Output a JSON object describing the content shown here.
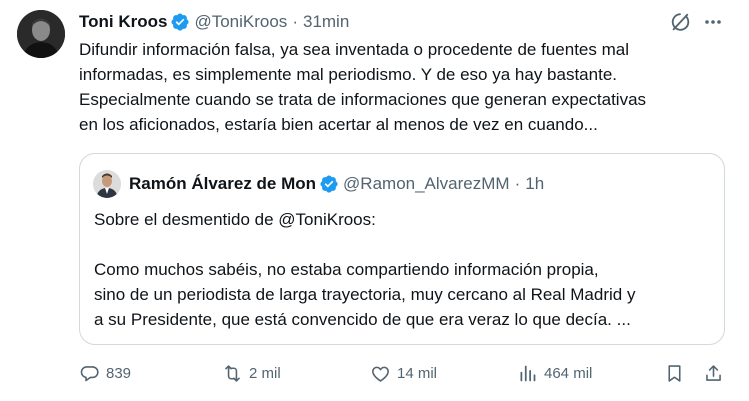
{
  "tweet": {
    "author_name": "Toni Kroos",
    "author_handle": "@ToniKroos",
    "separator": "·",
    "time": "31min",
    "text": "Difundir información falsa, ya sea inventada o procedente de fuentes mal\ninformadas, es simplemente mal periodismo. Y de eso ya hay bastante.\nEspecialmente cuando se trata de informaciones que generan expectativas\nen los aficionados, estaría bien acertar al menos de vez en cuando..."
  },
  "quote": {
    "author_name": "Ramón Álvarez de Mon",
    "author_handle": "@Ramon_AlvarezMM",
    "separator": "·",
    "time": "1h",
    "text": "Sobre el desmentido de @ToniKroos:\n\nComo muchos sabéis, no estaba compartiendo información propia,\nsino de un periodista de larga trayectoria, muy cercano al Real Madrid y\na su Presidente, que está convencido de que era veraz lo que decía. ..."
  },
  "actions": {
    "replies": "839",
    "reposts": "2 mil",
    "likes": "14 mil",
    "views": "464 mil"
  },
  "icons": {
    "verified": "verified-badge-icon",
    "grok": "grok-icon",
    "more": "more-icon",
    "reply": "reply-icon",
    "repost": "repost-icon",
    "like": "heart-icon",
    "views": "views-icon",
    "bookmark": "bookmark-icon",
    "share": "share-icon"
  },
  "colors": {
    "text": "#0f1419",
    "secondary": "#536471",
    "verified": "#1d9bf0",
    "border": "#cfd9de"
  }
}
